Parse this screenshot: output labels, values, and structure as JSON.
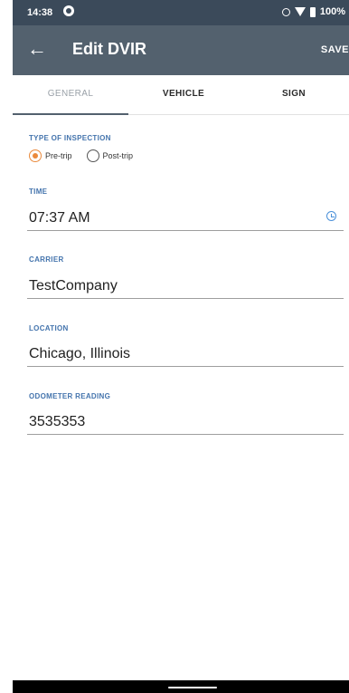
{
  "status_bar": {
    "time": "14:38",
    "battery": "100%",
    "icons": [
      "sync-icon",
      "key-icon",
      "wifi-icon",
      "battery-icon"
    ]
  },
  "app_bar": {
    "title": "Edit DVIR",
    "save_label": "SAVE",
    "back_icon": "arrow-left-icon"
  },
  "tabs": [
    {
      "label": "GENERAL",
      "active": true
    },
    {
      "label": "VEHICLE",
      "active": false
    },
    {
      "label": "SIGN",
      "active": false
    }
  ],
  "form": {
    "inspection": {
      "label": "TYPE OF INSPECTION",
      "options": [
        "Pre-trip",
        "Post-trip"
      ],
      "selected": "Pre-trip"
    },
    "time": {
      "label": "TIME",
      "value": "07:37 AM"
    },
    "carrier": {
      "label": "CARRIER",
      "value": "TestCompany"
    },
    "location": {
      "label": "LOCATION",
      "value": "Chicago, Illinois"
    },
    "odometer": {
      "label": "ODOMETER READING",
      "value": "3535353"
    }
  },
  "colors": {
    "status_bar": "#3b4a5a",
    "app_bar": "#53616e",
    "section_label": "#4474ad",
    "radio_accent": "#ea8a3d",
    "clock_icon": "#4a90d9"
  }
}
